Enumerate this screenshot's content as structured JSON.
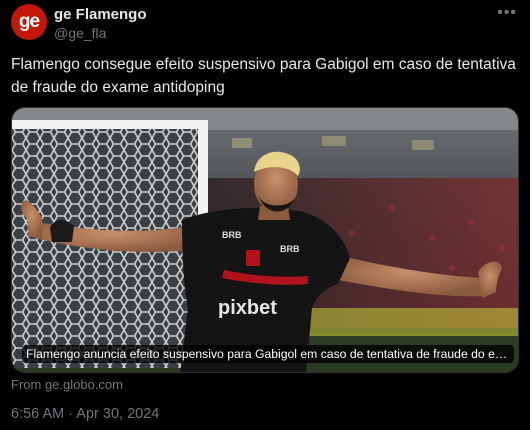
{
  "author": {
    "avatar_text": "ge",
    "display_name": "ge Flamengo",
    "handle": "@ge_fla",
    "avatar_color": "#c4170c"
  },
  "more_icon": "more-horizontal-icon",
  "tweet": {
    "text": "Flamengo consegue efeito suspensivo para Gabigol em caso de tentativa de fraude do exame antidoping"
  },
  "media": {
    "caption": "Flamengo anuncia efeito suspensivo para Gabigol em caso de tentativa de fraude do exame antidoping",
    "shirt_sponsor": "pixbet",
    "sleeve_brand": "BRB"
  },
  "source": "From ge.globo.com",
  "timestamp": "6:56 AM · Apr 30, 2024",
  "colors": {
    "background": "#000000",
    "text_primary": "#e7e9ea",
    "text_secondary": "#71767b",
    "brand": "#c4170c"
  }
}
